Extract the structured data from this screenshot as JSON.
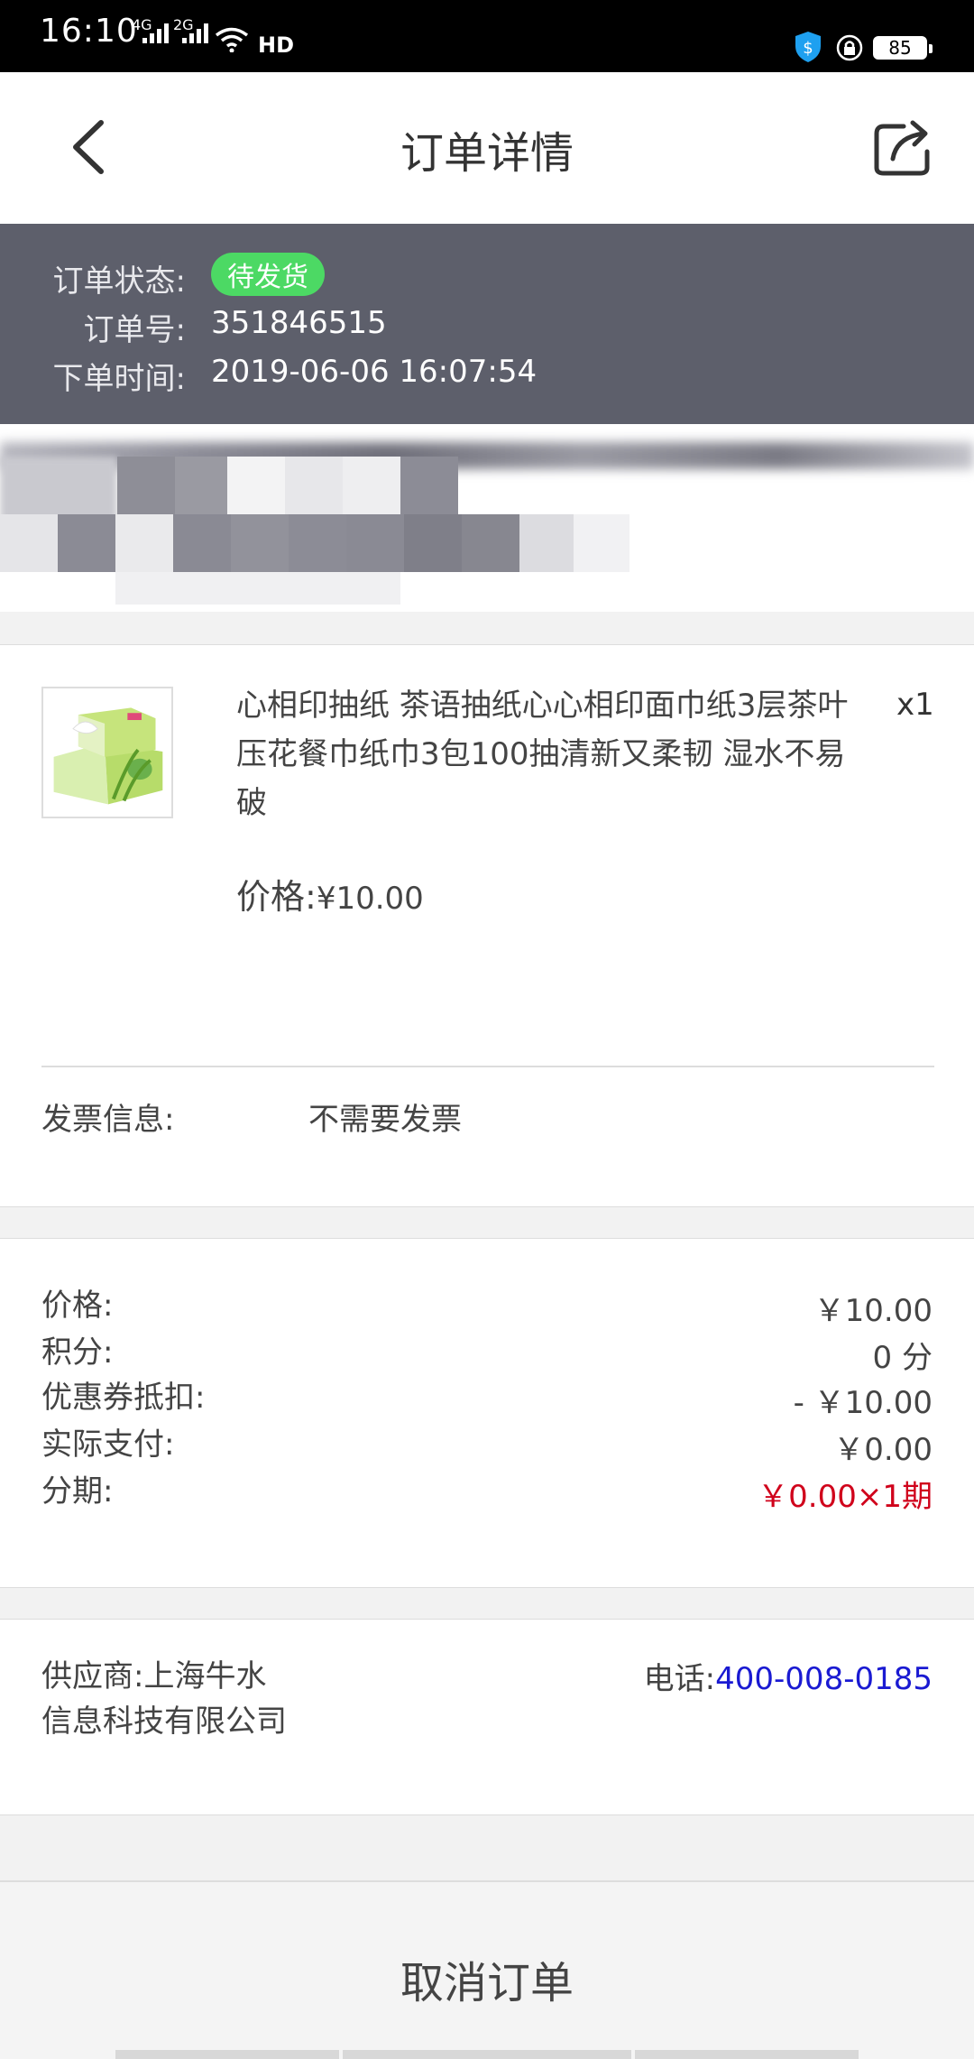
{
  "status_bar": {
    "time": "16:10",
    "signal_1": "4G",
    "signal_2": "2G",
    "hd": "HD",
    "battery": "85"
  },
  "header": {
    "title": "订单详情",
    "back_icon": "chevron-left-icon",
    "share_icon": "share-icon"
  },
  "order": {
    "status_label": "订单状态:",
    "status_value": "待发货",
    "number_label": "订单号:",
    "number_value": "351846515",
    "time_label": "下单时间:",
    "time_value": "2019-06-06 16:07:54",
    "status_color": "#4cd964"
  },
  "product": {
    "name": "心相印抽纸 茶语抽纸心心相印面巾纸3层茶叶压花餐巾纸巾3包100抽清新又柔韧 湿水不易破",
    "quantity": "x1",
    "price_label": "价格:",
    "price_value": "¥10.00"
  },
  "invoice": {
    "label": "发票信息:",
    "value": "不需要发票"
  },
  "summary": {
    "rows": [
      {
        "label": "价格:",
        "value": "￥10.00"
      },
      {
        "label": "积分:",
        "value": "0 分"
      },
      {
        "label": "优惠券抵扣:",
        "value": "- ￥10.00"
      },
      {
        "label": "实际支付:",
        "value": "￥0.00"
      },
      {
        "label": "分期:",
        "value": "￥0.00×1期"
      }
    ],
    "highlight_color": "#d0021b"
  },
  "supplier": {
    "name_line1": "供应商:上海牛水",
    "name_line2": "信息科技有限公司",
    "phone_label": "电话:",
    "phone_value": "400-008-0185"
  },
  "actions": {
    "cancel_label": "取消订单"
  }
}
